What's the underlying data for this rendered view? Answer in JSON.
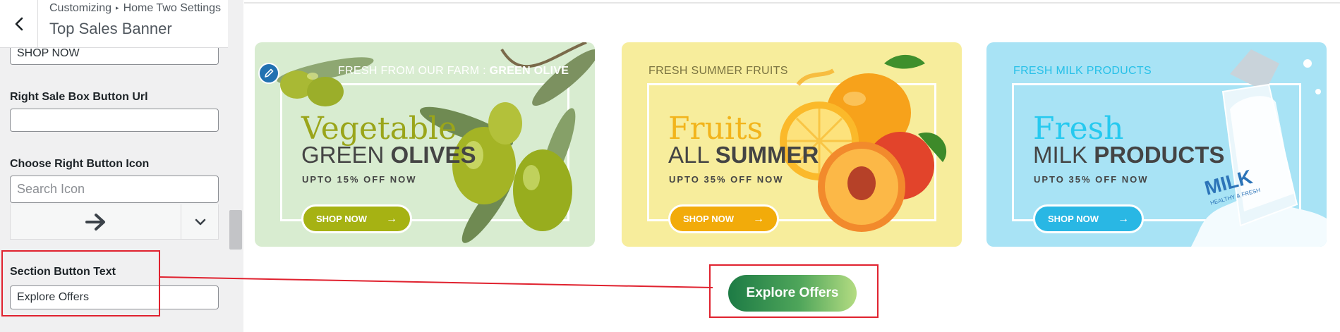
{
  "sidebar": {
    "breadcrumb": {
      "root": "Customizing",
      "separator": "▸",
      "section": "Home Two Settings"
    },
    "title": "Top Sales Banner",
    "fields": {
      "shop_now_value": "SHOP NOW",
      "right_url_label": "Right Sale Box Button Url",
      "right_url_value": "",
      "icon_label": "Choose Right Button Icon",
      "icon_search_placeholder": "Search Icon",
      "selected_icon": "arrow-right-icon",
      "section_button_label": "Section Button Text",
      "section_button_value": "Explore Offers"
    }
  },
  "preview": {
    "banners": [
      {
        "tagline_prefix": "FRESH FROM OUR FARM : ",
        "tagline_bold": "GREEN OLIVE",
        "title": "Vegetable",
        "subtitle_light": "GREEN ",
        "subtitle_bold": "OLIVES",
        "offer": "UPTO 15% OFF NOW",
        "button": "SHOP NOW",
        "accent": "#a6b213"
      },
      {
        "tagline_prefix": "FRESH SUMMER FRUITS",
        "title": "Fruits",
        "subtitle_light": "ALL ",
        "subtitle_bold": "SUMMER",
        "offer": "UPTO 35% OFF NOW",
        "button": "SHOP NOW",
        "accent": "#f2ab0a"
      },
      {
        "tagline_prefix": "FRESH MILK PRODUCTS",
        "title": "Fresh",
        "subtitle_light": "MILK ",
        "subtitle_bold": "PRODUCTS",
        "offer": "UPTO 35% OFF NOW",
        "button": "SHOP NOW",
        "bottle_label": "MILK",
        "bottle_sublabel": "HEALTHY & FRESH",
        "accent": "#29b7e4"
      }
    ],
    "explore_button": "Explore Offers"
  },
  "colors": {
    "highlight": "#e0222f",
    "wp_blue": "#2271b1"
  }
}
